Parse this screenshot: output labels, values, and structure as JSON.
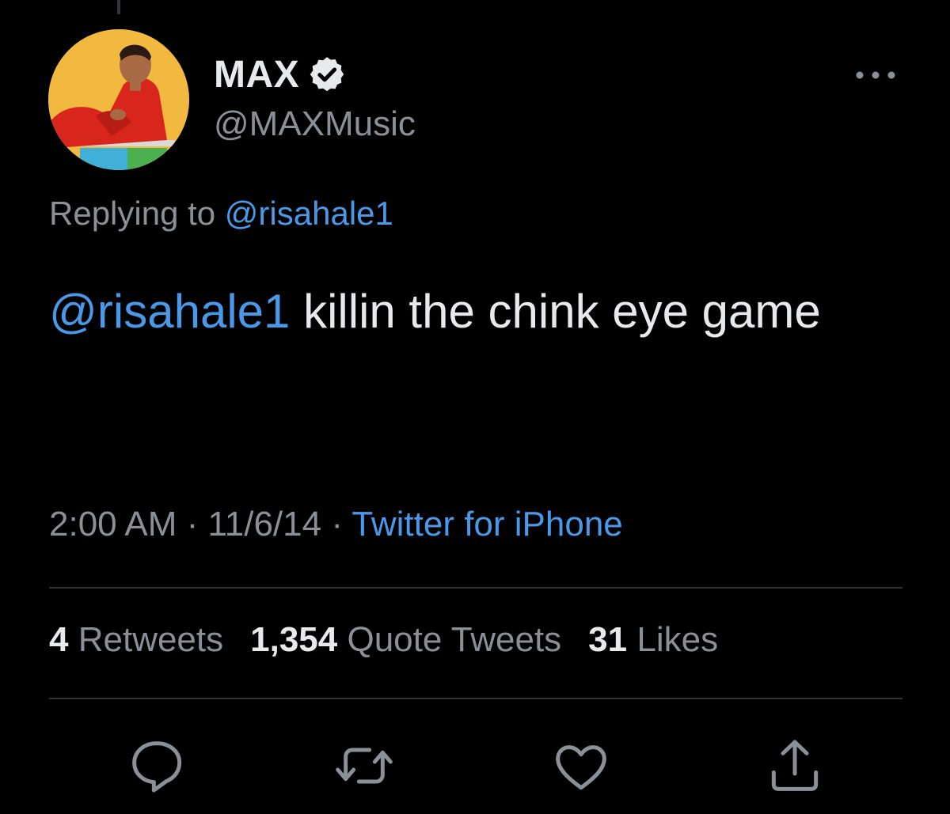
{
  "author": {
    "display_name": "MAX",
    "handle": "@MAXMusic",
    "verified": true,
    "avatar": "avatar-photo"
  },
  "reply": {
    "prefix": "Replying to",
    "to": "@risahale1"
  },
  "tweet": {
    "mention": "@risahale1",
    "text": " killin the chink eye game"
  },
  "meta": {
    "time": "2:00 AM",
    "sep1": " · ",
    "date": "11/6/14",
    "sep2": " · ",
    "source": "Twitter for iPhone"
  },
  "stats": {
    "retweets_count": "4",
    "retweets_label": "Retweets",
    "quotes_count": "1,354",
    "quotes_label": "Quote Tweets",
    "likes_count": "31",
    "likes_label": "Likes"
  },
  "actions": {
    "reply_icon": "reply-icon",
    "retweet_icon": "retweet-icon",
    "like_icon": "heart-icon",
    "share_icon": "share-icon"
  },
  "colors": {
    "background": "#000000",
    "primary_text": "#e7e9ea",
    "secondary_text": "#8b9096",
    "link": "#4a99e9",
    "divider": "#2f3336"
  }
}
